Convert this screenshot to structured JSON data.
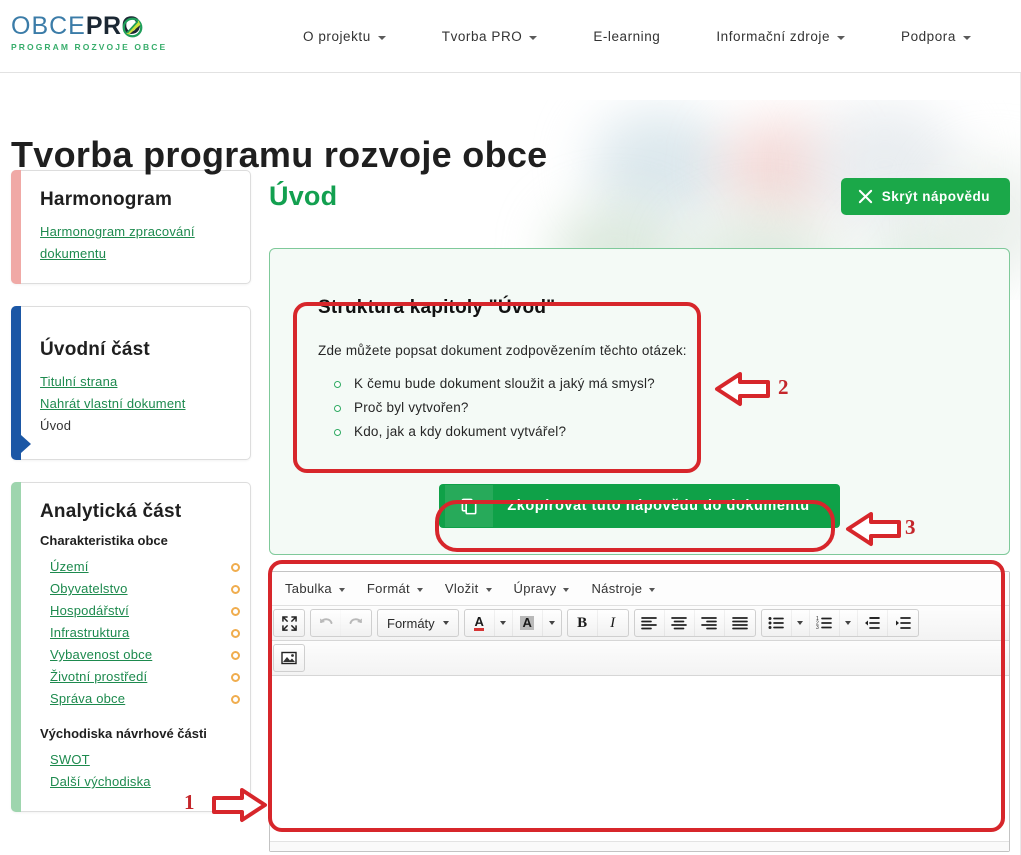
{
  "header": {
    "logo": {
      "part1": "OBCE",
      "part2": "PRO",
      "tagline": "PROGRAM ROZVOJE OBCE",
      "mark_icon": "green-circle-swoosh-icon"
    },
    "nav": [
      {
        "label": "O projektu",
        "has_dropdown": true
      },
      {
        "label": "Tvorba PRO",
        "has_dropdown": true
      },
      {
        "label": "E-learning",
        "has_dropdown": false
      },
      {
        "label": "Informační zdroje",
        "has_dropdown": true
      },
      {
        "label": "Podpora",
        "has_dropdown": true
      }
    ]
  },
  "page": {
    "title": "Tvorba programu rozvoje obce"
  },
  "sidebar": {
    "cards": [
      {
        "title": "Harmonogram",
        "accent": "pink",
        "links": [
          {
            "label": "Harmonogram zpracování dokumentu",
            "type": "link"
          }
        ]
      },
      {
        "title": "Úvodní část",
        "accent": "blue",
        "active": true,
        "links": [
          {
            "label": "Titulní strana",
            "type": "link"
          },
          {
            "label": "Nahrát vlastní dokument",
            "type": "link"
          },
          {
            "label": "Úvod",
            "type": "plain"
          }
        ]
      },
      {
        "title": "Analytická část",
        "accent": "green",
        "groups": [
          {
            "subtitle": "Charakteristika obce",
            "items": [
              {
                "label": "Území",
                "status": "pending"
              },
              {
                "label": "Obyvatelstvo",
                "status": "pending"
              },
              {
                "label": "Hospodářství",
                "status": "pending"
              },
              {
                "label": "Infrastruktura",
                "status": "pending"
              },
              {
                "label": "Vybavenost obce",
                "status": "pending"
              },
              {
                "label": "Životní prostředí",
                "status": "pending"
              },
              {
                "label": "Správa obce",
                "status": "pending"
              }
            ]
          },
          {
            "subtitle": "Východiska návrhové části",
            "items": [
              {
                "label": "SWOT",
                "status": "none"
              },
              {
                "label": "Další východiska",
                "status": "none"
              }
            ]
          }
        ]
      }
    ]
  },
  "main": {
    "section_title": "Úvod",
    "hide_help_button": {
      "label": "Skrýt nápovědu",
      "icon": "close-x-icon"
    },
    "help": {
      "title": "Struktura kapitoly \"Úvod\"",
      "intro": "Zde můžete popsat dokument zodpovězením těchto otázek:",
      "bullets": [
        "K čemu bude dokument sloužit a jaký má smysl?",
        "Proč byl vytvořen?",
        "Kdo, jak a kdy dokument vytvářel?"
      ],
      "copy_button": {
        "label": "Zkopírovat tuto nápovědu do dokumentu",
        "icon": "copy-icon"
      }
    },
    "editor": {
      "menubar": [
        {
          "label": "Tabulka"
        },
        {
          "label": "Formát"
        },
        {
          "label": "Vložit"
        },
        {
          "label": "Úpravy"
        },
        {
          "label": "Nástroje"
        }
      ],
      "toolbar_row1": [
        {
          "name": "fullscreen-icon",
          "kind": "icon",
          "disabled": false
        },
        {
          "name": "undo-icon",
          "kind": "icon",
          "disabled": true
        },
        {
          "name": "redo-icon",
          "kind": "icon",
          "disabled": true
        },
        {
          "name": "formats-dropdown",
          "kind": "text",
          "label": "Formáty"
        },
        {
          "name": "text-color-icon",
          "kind": "split"
        },
        {
          "name": "background-color-icon",
          "kind": "split"
        },
        {
          "name": "bold-icon",
          "kind": "icon"
        },
        {
          "name": "italic-icon",
          "kind": "icon"
        },
        {
          "name": "align-left-icon",
          "kind": "icon"
        },
        {
          "name": "align-center-icon",
          "kind": "icon"
        },
        {
          "name": "align-right-icon",
          "kind": "icon"
        },
        {
          "name": "align-justify-icon",
          "kind": "icon"
        },
        {
          "name": "bullet-list-icon",
          "kind": "split"
        },
        {
          "name": "numbered-list-icon",
          "kind": "split"
        },
        {
          "name": "outdent-icon",
          "kind": "icon"
        },
        {
          "name": "indent-icon",
          "kind": "icon"
        }
      ],
      "toolbar_row2": [
        {
          "name": "insert-image-icon",
          "kind": "icon"
        }
      ],
      "content": ""
    }
  },
  "annotations": [
    {
      "number": "1",
      "direction": "right",
      "target": "editor-area"
    },
    {
      "number": "2",
      "direction": "left",
      "target": "help-structure-box"
    },
    {
      "number": "3",
      "direction": "left",
      "target": "copy-help-button"
    }
  ],
  "colors": {
    "brand_green": "#1ba849",
    "title_green": "#13a050",
    "link_green": "#1d8a4e",
    "logo_blue": "#3b7ca8",
    "annotation_red": "#d7262b",
    "accent_pink": "#f0a9a6",
    "accent_blue": "#1b57a5",
    "accent_green": "#9ed5ae",
    "status_orange": "#f0ad4e"
  }
}
